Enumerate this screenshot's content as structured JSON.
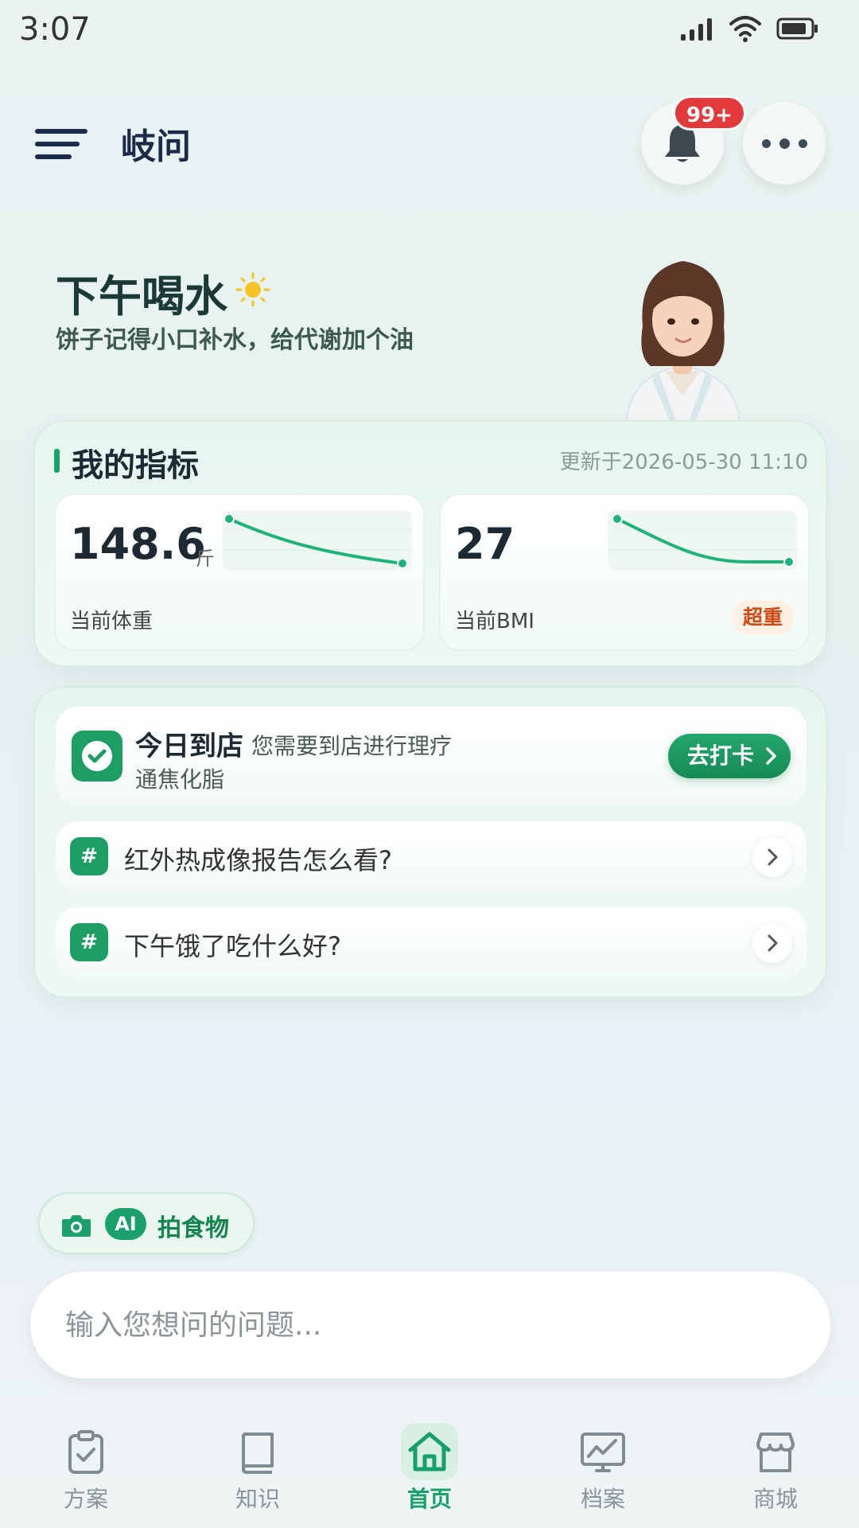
{
  "status_bar": {
    "time": "3:07"
  },
  "header": {
    "title": "岐问",
    "notification_badge": "99+"
  },
  "greeting": {
    "title": "下午喝水",
    "subtitle": "饼子记得小口补水，给代谢加个油"
  },
  "metrics": {
    "title": "我的指标",
    "updated": "更新于2026-05-30 11:10",
    "weight": {
      "value": "148.6",
      "unit": "斤",
      "label": "当前体重"
    },
    "bmi": {
      "value": "27",
      "label": "当前BMI",
      "status": "超重"
    }
  },
  "tasks": {
    "visit": {
      "title": "今日到店",
      "desc": "您需要到店进行理疗",
      "sub": "通焦化脂",
      "button": "去打卡"
    },
    "questions": [
      {
        "text": "红外热成像报告怎么看?"
      },
      {
        "text": "下午饿了吃什么好?"
      }
    ]
  },
  "ai_photo": {
    "pill": "AI",
    "label": "拍食物"
  },
  "input": {
    "placeholder": "输入您想问的问题..."
  },
  "tabs": [
    {
      "label": "方案",
      "icon": "clipboard-check-icon"
    },
    {
      "label": "知识",
      "icon": "book-icon"
    },
    {
      "label": "首页",
      "icon": "home-icon",
      "active": true
    },
    {
      "label": "档案",
      "icon": "chart-icon"
    },
    {
      "label": "商城",
      "icon": "store-icon"
    }
  ],
  "colors": {
    "accent": "#18a06b",
    "badge": "#e23a3a",
    "warning": "#d04a18"
  }
}
